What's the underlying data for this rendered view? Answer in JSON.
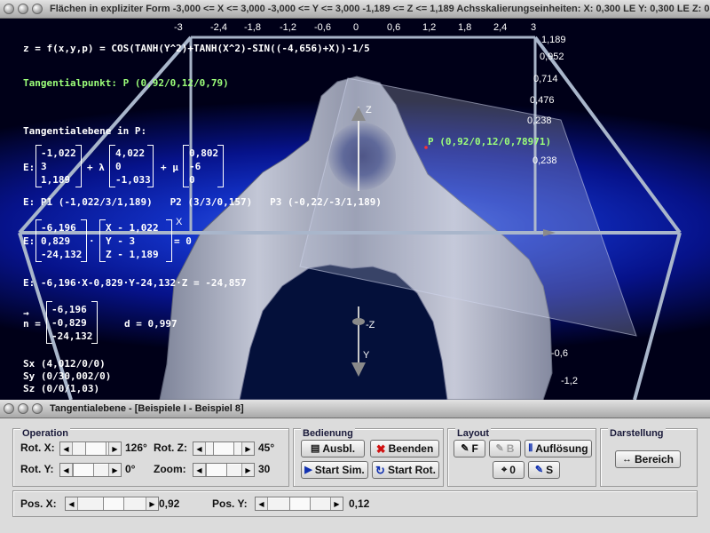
{
  "window_3d": {
    "title": "Flächen in expliziter Form   -3,000 <= X <= 3,000   -3,000 <= Y <= 3,000   -1,189 <= Z <= 1,189   Achsskalierungseinheiten:  X: 0,300 LE   Y: 0,300 LE   Z: 0,238 LE"
  },
  "overlay": {
    "function": "z = f(x,y,p) = COS(TANH(Y^2)+TANH(X^2)-SIN((-4,656)+X))-1/5",
    "tangent_point": "Tangentialpunkt: P (0,92/0,12/0,79)",
    "plane_heading": "Tangentialebene in P:",
    "vec_e_label": "E:",
    "vec1": [
      "-1,022",
      "3",
      "1,189"
    ],
    "vec2": [
      "4,022",
      "0",
      "-1,033"
    ],
    "vec3": [
      "0,802",
      "-6",
      "0"
    ],
    "plus_lambda": "+ λ",
    "plus_mu": "+ μ",
    "points_line": "E: P1 (-1,022/3/1,189)   P2 (3/3/0,157)   P3 (-0,22/-3/1,189)",
    "normal_label": "E:",
    "nvec": [
      "-6,196",
      "0,829",
      "-24,132"
    ],
    "xyz_vec": [
      "X - 1,022",
      "Y - 3",
      "Z - 1,189"
    ],
    "dot": "·",
    "eq_zero": "= 0",
    "coord_eq": "E: -6,196·X-0,829·Y-24,132·Z = -24,857",
    "n_arrow": "→",
    "n_label": "n =",
    "n_vec": [
      "-6,196",
      "-0,829",
      "-24,132"
    ],
    "d_label": "d = 0,997",
    "sx": "Sx (4,012/0/0)",
    "sy": "Sy (0/30,002/0)",
    "sz": "Sz (0/0/1,03)",
    "p_label": "P (0,92/0,12/0,78971)"
  },
  "axes": {
    "x_ticks": [
      "-3",
      "-2,4",
      "-1,8",
      "-1,2",
      "-0,6",
      "0",
      "0,6",
      "1,2",
      "1,8",
      "2,4",
      "3"
    ],
    "z_ticks": [
      "1,189",
      "0,952",
      "0,714",
      "0,476",
      "0,238",
      "0,238"
    ],
    "y_ticks": [
      "-0,6",
      "-1,2"
    ],
    "z_axis": "Z",
    "x_axis": "X",
    "neg_z_axis": "-Z",
    "y_axis": "Y"
  },
  "window_ctrl": {
    "title": "Tangentialebene - [Beispiele I - Beispiel 8]"
  },
  "operation": {
    "title": "Operation",
    "rot_x_label": "Rot. X:",
    "rot_x_value": "126°",
    "rot_y_label": "Rot. Y:",
    "rot_y_value": "0°",
    "rot_z_label": "Rot. Z:",
    "rot_z_value": "45°",
    "zoom_label": "Zoom:",
    "zoom_value": "30"
  },
  "bedienung": {
    "title": "Bedienung",
    "ausbl": "Ausbl.",
    "beenden": "Beenden",
    "start_sim": "Start Sim.",
    "start_rot": "Start Rot."
  },
  "layout": {
    "title": "Layout",
    "f": "F",
    "b": "B",
    "aufloesung": "Auflösung",
    "zero": "0",
    "s": "S"
  },
  "darstellung": {
    "title": "Darstellung",
    "bereich": "Bereich"
  },
  "pos": {
    "x_label": "Pos. X:",
    "x_value": "0,92",
    "y_label": "Pos. Y:",
    "y_value": "0,12"
  }
}
